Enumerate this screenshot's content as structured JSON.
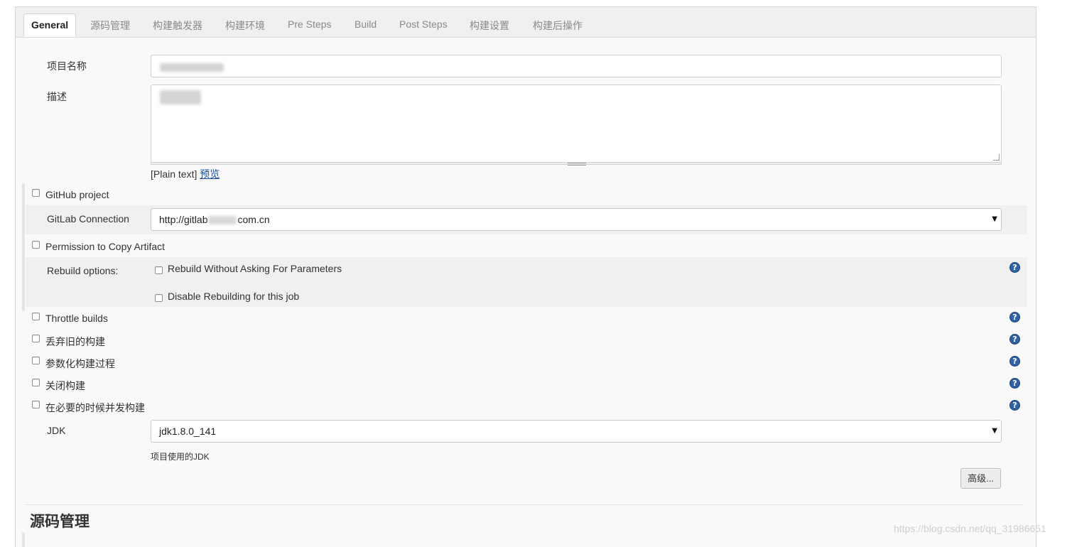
{
  "tabs": [
    {
      "label": "General",
      "active": true
    },
    {
      "label": "源码管理"
    },
    {
      "label": "构建触发器"
    },
    {
      "label": "构建环境"
    },
    {
      "label": "Pre Steps"
    },
    {
      "label": "Build"
    },
    {
      "label": "Post Steps"
    },
    {
      "label": "构建设置"
    },
    {
      "label": "构建后操作"
    }
  ],
  "form": {
    "project_name_label": "项目名称",
    "description_label": "描述",
    "plain_text": "[Plain text]",
    "preview_link": "预览",
    "github_project": "GitHub project",
    "gitlab_connection_label": "GitLab Connection",
    "gitlab_connection_value_prefix": "http://gitlab",
    "gitlab_connection_value_suffix": "com.cn",
    "permission_copy_artifact": "Permission to Copy Artifact",
    "rebuild_options_label": "Rebuild options:",
    "rebuild_without_asking": "Rebuild Without Asking For Parameters",
    "disable_rebuilding": "Disable Rebuilding for this job",
    "throttle_builds": "Throttle builds",
    "discard_old_builds": "丢弃旧的构建",
    "parameterized": "参数化构建过程",
    "disable_build": "关闭构建",
    "concurrent_builds": "在必要的时候并发构建",
    "jdk_label": "JDK",
    "jdk_value": "jdk1.8.0_141",
    "jdk_hint": "项目使用的JDK",
    "advanced_button": "高级..."
  },
  "section_title": "源码管理",
  "watermark": "https://blog.csdn.net/qq_31986651",
  "icons": {
    "help": "help-icon",
    "dropdown": "chevron-down-icon"
  },
  "colors": {
    "help_icon": "#2f62a6",
    "link": "#1a4f9c"
  }
}
